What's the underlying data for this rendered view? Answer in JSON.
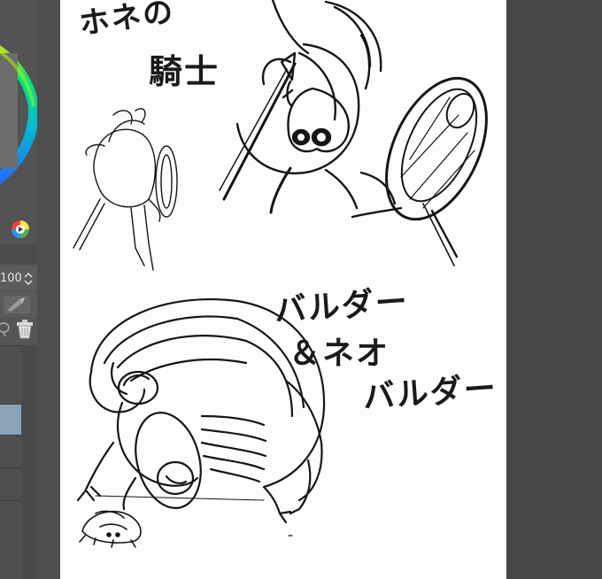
{
  "app": {
    "opacity_value": "100"
  },
  "drawing": {
    "title_line1": "ホネの",
    "title_line2": "騎士",
    "caption_line1": "バルダー",
    "caption_line2": "＆ネオ",
    "caption_line3": "バルダー"
  },
  "colors": {
    "ui_dark": "#535353",
    "ui_panel": "#474747",
    "canvas": "#fdfdfd",
    "layer_selected": "#8aa3b7",
    "ink": "#1a1a1a"
  },
  "icons": {
    "color_wheel": "color-wheel-icon",
    "color_mixer": "color-mixer-icon",
    "spinner": "spinner-arrows-icon",
    "pen_tool": "pen-tool-icon",
    "lasso": "lasso-icon",
    "trash": "trash-icon"
  }
}
